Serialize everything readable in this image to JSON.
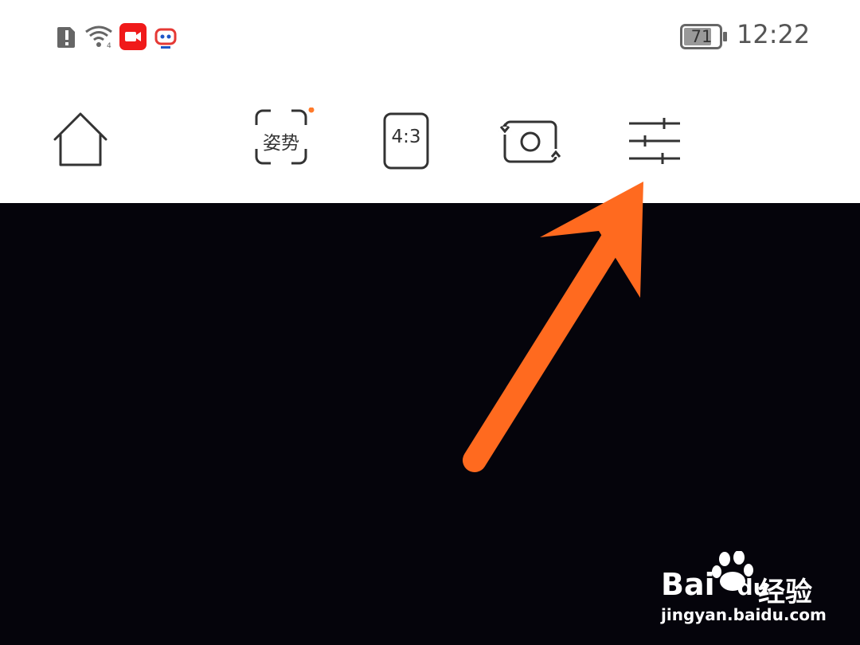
{
  "status_bar": {
    "time": "12:22",
    "battery_level": "71",
    "icons": [
      "alert-icon",
      "wifi-icon",
      "video-record-icon",
      "robot-app-icon",
      "battery-icon"
    ]
  },
  "toolbar": {
    "home_icon": "home-icon",
    "pose_label": "姿势",
    "pose_has_dot": true,
    "aspect_ratio_label": "4:3",
    "switch_camera_icon": "switch-camera-icon",
    "settings_icon": "settings-sliders-icon"
  },
  "annotation": {
    "arrow_color": "#ff6a1f"
  },
  "watermark": {
    "brand": "Bai",
    "brand_suffix": "du",
    "brand_cn": "经验",
    "url": "jingyan.baidu.com"
  }
}
